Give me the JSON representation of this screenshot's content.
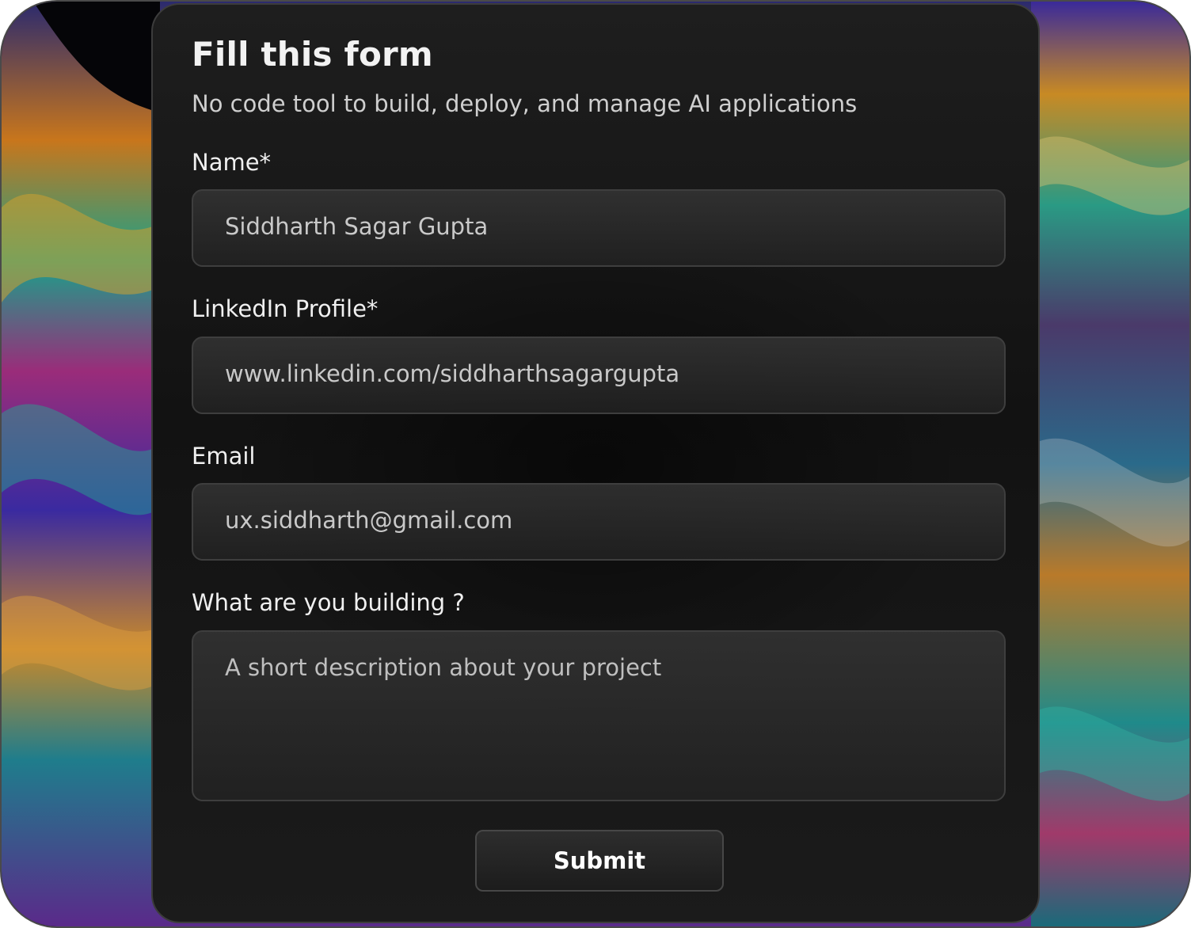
{
  "form": {
    "title": "Fill this form",
    "subtitle": "No code tool to build, deploy, and manage AI applications",
    "fields": [
      {
        "label": "Name*",
        "value": "Siddharth Sagar Gupta"
      },
      {
        "label": "LinkedIn Profile*",
        "value": "www.linkedin.com/siddharthsagargupta"
      },
      {
        "label": "Email",
        "value": "ux.siddharth@gmail.com"
      },
      {
        "label": "What are you building ?",
        "placeholder": "A short description about your project"
      }
    ],
    "submit_label": "Submit"
  },
  "colors": {
    "card_background": "#161616",
    "field_border": "#3e3e3e",
    "text_primary": "#f2f2f2",
    "text_secondary": "#c9c9c9"
  }
}
